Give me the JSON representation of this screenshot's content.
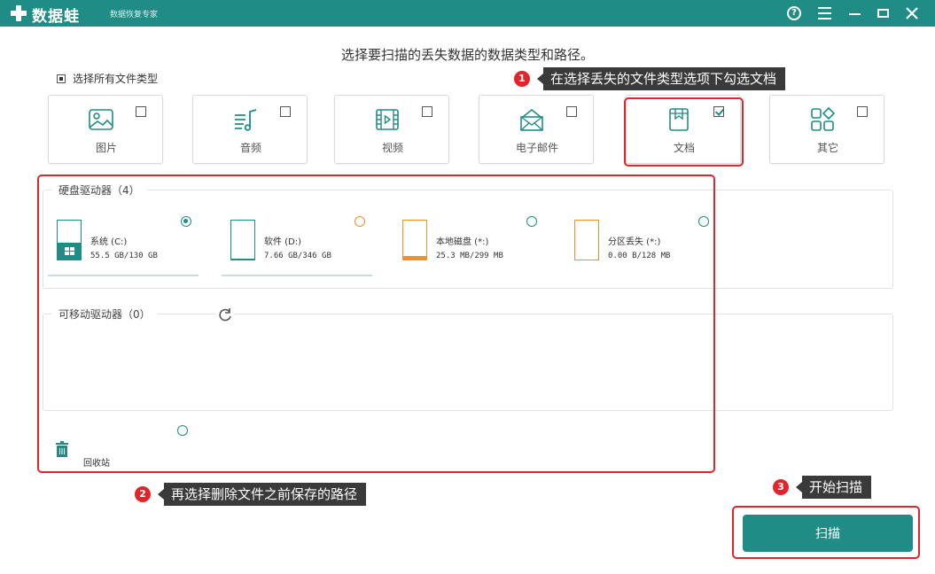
{
  "app": {
    "name": "数据蛙",
    "subtitle": "数据恢复专家",
    "title_buttons": [
      "help-icon",
      "menu-icon",
      "minimize-icon",
      "maximize-icon",
      "close-icon"
    ]
  },
  "heading": "选择要扫描的丢失数据的数据类型和路径。",
  "select_all_label": "选择所有文件类型",
  "file_types": [
    {
      "label": "图片",
      "icon": "image-icon",
      "checked": false
    },
    {
      "label": "音频",
      "icon": "audio-icon",
      "checked": false
    },
    {
      "label": "视频",
      "icon": "video-icon",
      "checked": false
    },
    {
      "label": "电子邮件",
      "icon": "email-icon",
      "checked": false
    },
    {
      "label": "文档",
      "icon": "document-icon",
      "checked": true
    },
    {
      "label": "其它",
      "icon": "other-icon",
      "checked": false
    }
  ],
  "hard_drives": {
    "title": "硬盘驱动器（4）",
    "items": [
      {
        "name": "系统 (C:)",
        "size": "55.5 GB/130 GB",
        "selected": true,
        "fill": 0.43,
        "color": "#1f8d85"
      },
      {
        "name": "软件 (D:)",
        "size": "7.66 GB/346 GB",
        "selected": false,
        "fill": 0.02,
        "color": "#1f8d85"
      },
      {
        "name": "本地磁盘 (*:)",
        "size": "25.3 MB/299 MB",
        "selected": false,
        "fill": 0.08,
        "color": "#f0902a"
      },
      {
        "name": "分区丢失 (*:)",
        "size": "0.00  B/128 MB",
        "selected": false,
        "fill": 0.0,
        "color": "#f0902a"
      }
    ]
  },
  "removable": {
    "title": "可移动驱动器（0）",
    "refresh_icon": "refresh-icon"
  },
  "recycle_bin": {
    "label": "回收站",
    "icon": "trash-icon",
    "selected": false
  },
  "callouts": [
    {
      "num": "1",
      "text": "在选择丢失的文件类型选项下勾选文档"
    },
    {
      "num": "2",
      "text": "再选择删除文件之前保存的路径"
    },
    {
      "num": "3",
      "text": "开始扫描"
    }
  ],
  "scan_button": "扫描",
  "colors": {
    "accent": "#1f8d85",
    "highlight": "#e0262a",
    "orange": "#f0902a"
  }
}
